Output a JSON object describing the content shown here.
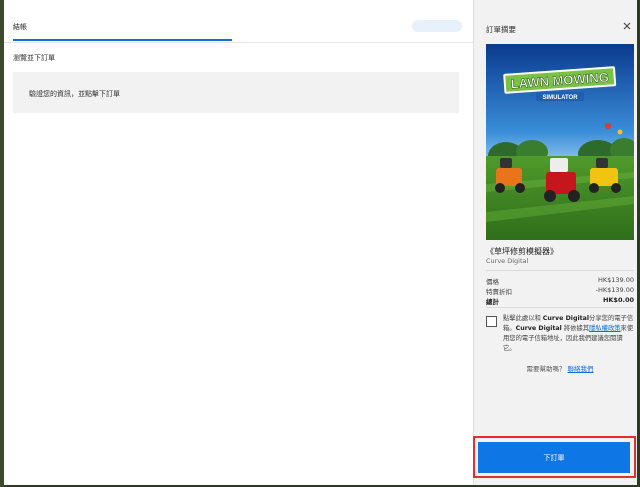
{
  "checkout": {
    "tab_label": "結帳",
    "section_title": "瀏覽並下訂單",
    "info_text": "驗證您的資訊，並點擊下訂單"
  },
  "summary": {
    "header": "訂單摘要",
    "close_icon": "close-icon",
    "cover": {
      "logo_line1": "LAWN MOWING",
      "logo_line2": "SIMULATOR"
    },
    "game_title": "《草坪修剪模擬器》",
    "publisher": "Curve Digital",
    "price_label": "價格",
    "price_value": "HK$139.00",
    "discount_label": "特賣折扣",
    "discount_value": "-HK$139.00",
    "total_label": "總計",
    "total_value": "HK$0.00",
    "consent_part1": "點擊此處以和 ",
    "consent_brand1": "Curve Digital",
    "consent_part2": "分享您的電子信箱。",
    "consent_brand2": "Curve Digital",
    "consent_part3": " 將依據其",
    "consent_link": "隱私權政策",
    "consent_part4": "來使用您的電子信箱地址，因此我們建議您閱讀它。",
    "help_text": "需要幫助嗎？",
    "help_link": "聯絡我們"
  },
  "place_order_label": "下訂單",
  "colors": {
    "accent": "#0f76e6",
    "highlight_outline": "#e03030",
    "summary_bg": "#f2f2f2"
  }
}
